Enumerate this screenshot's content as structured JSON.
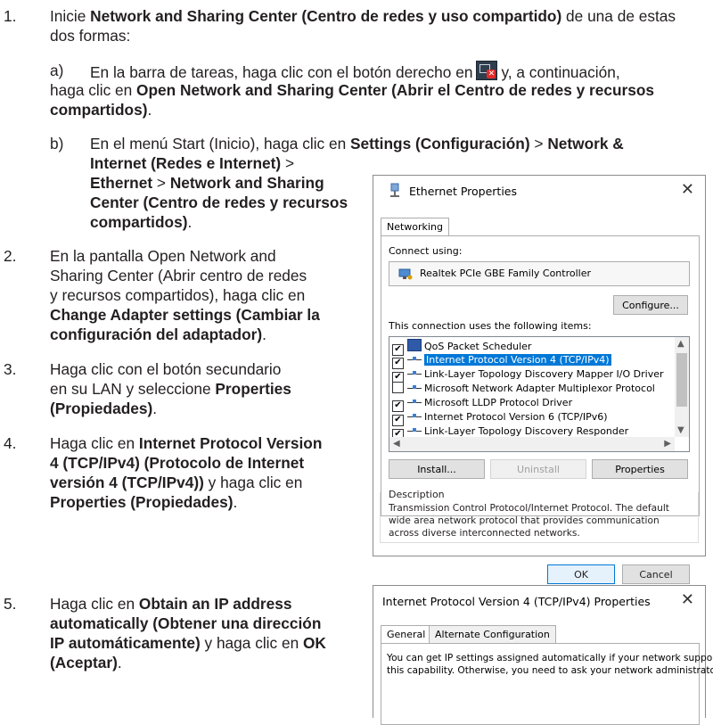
{
  "steps": {
    "s1": {
      "num": "1.",
      "line1_pre": "Inicie ",
      "line1_bold": "Network and Sharing Center (Centro de redes y uso compartido)",
      "line1_post": " de una de estas",
      "line2": "dos formas:"
    },
    "s1a": {
      "letter": "a)",
      "line1_pre": "En la barra de tareas, haga clic con el botón derecho en",
      "line1_post": "y, a continuación,",
      "line2_pre": "haga clic en ",
      "line2_bold": "Open Network and Sharing Center (Abrir el Centro de redes y recursos",
      "line3_bold": "compartidos)",
      "line3_post": "."
    },
    "s1b": {
      "letter": "b)",
      "line1_pre": "En el menú Start (Inicio), haga clic en ",
      "line1_bold1": "Settings (Configuración)",
      "line1_mid": " > ",
      "line1_bold2": "Network &",
      "line2_bold": "Internet (Redes e Internet)",
      "line2_post": " >",
      "line3_bold1": "Ethernet",
      "line3_mid": " > ",
      "line3_bold2": "Network and Sharing",
      "line4_bold": "Center (Centro de redes y recursos",
      "line5_bold": "compartidos)",
      "line5_post": "."
    },
    "s2": {
      "num": "2.",
      "line1": "En la pantalla Open Network and",
      "line2": "Sharing Center (Abrir centro de redes",
      "line3": "y recursos compartidos), haga clic en",
      "line4_bold": "Change Adapter settings (Cambiar la",
      "line5_bold": "configuración del adaptador)",
      "line5_post": "."
    },
    "s3": {
      "num": "3.",
      "line1": "Haga clic con el botón secundario",
      "line2_pre": "en su LAN y seleccione ",
      "line2_bold": "Properties",
      "line3_bold": "(Propiedades)",
      "line3_post": "."
    },
    "s4": {
      "num": "4.",
      "line1_pre": "Haga clic en ",
      "line1_bold": "Internet Protocol Version",
      "line2_bold": "4 (TCP/IPv4) (Protocolo de Internet",
      "line3_bold": "versión 4 (TCP/IPv4))",
      "line3_post": " y haga clic en",
      "line4_bold": "Properties (Propiedades)",
      "line4_post": "."
    },
    "s5": {
      "num": "5.",
      "line1_pre": "Haga clic en ",
      "line1_bold": "Obtain an IP address",
      "line2_bold": "automatically (Obtener una dirección",
      "line3_bold": "IP automáticamente)",
      "line3_post": " y haga clic en ",
      "line3_bold2": "OK",
      "line4_bold": "(Aceptar)",
      "line4_post": "."
    }
  },
  "dialog1": {
    "title": "Ethernet Properties",
    "tab": "Networking",
    "connect_using": "Connect using:",
    "adapter": "Realtek PCIe GBE Family Controller",
    "configure": "Configure...",
    "items_label": "This connection uses the following items:",
    "items": [
      {
        "label": "QoS Packet Scheduler",
        "checked": "✔"
      },
      {
        "label": "Internet Protocol Version 4 (TCP/IPv4)",
        "checked": "✔"
      },
      {
        "label": "Link-Layer Topology Discovery Mapper I/O Driver",
        "checked": "✔"
      },
      {
        "label": "Microsoft Network Adapter Multiplexor Protocol",
        "checked": ""
      },
      {
        "label": "Microsoft LLDP Protocol Driver",
        "checked": "✔"
      },
      {
        "label": "Internet Protocol Version 6 (TCP/IPv6)",
        "checked": "✔"
      },
      {
        "label": "Link-Layer Topology Discovery Responder",
        "checked": "✔"
      }
    ],
    "install": "Install...",
    "uninstall": "Uninstall",
    "properties": "Properties",
    "description_label": "Description",
    "description_lines": [
      "Transmission Control Protocol/Internet Protocol. The default",
      "wide area network protocol that provides communication",
      "across diverse interconnected networks."
    ],
    "ok": "OK",
    "cancel": "Cancel"
  },
  "dialog2": {
    "title": "Internet Protocol Version 4 (TCP/IPv4) Properties",
    "tab_general": "General",
    "tab_alternate": "Alternate Configuration",
    "text_lines": [
      "You can get IP settings assigned automatically if your network supports",
      "this capability. Otherwise, you need to ask your network administrator"
    ]
  }
}
